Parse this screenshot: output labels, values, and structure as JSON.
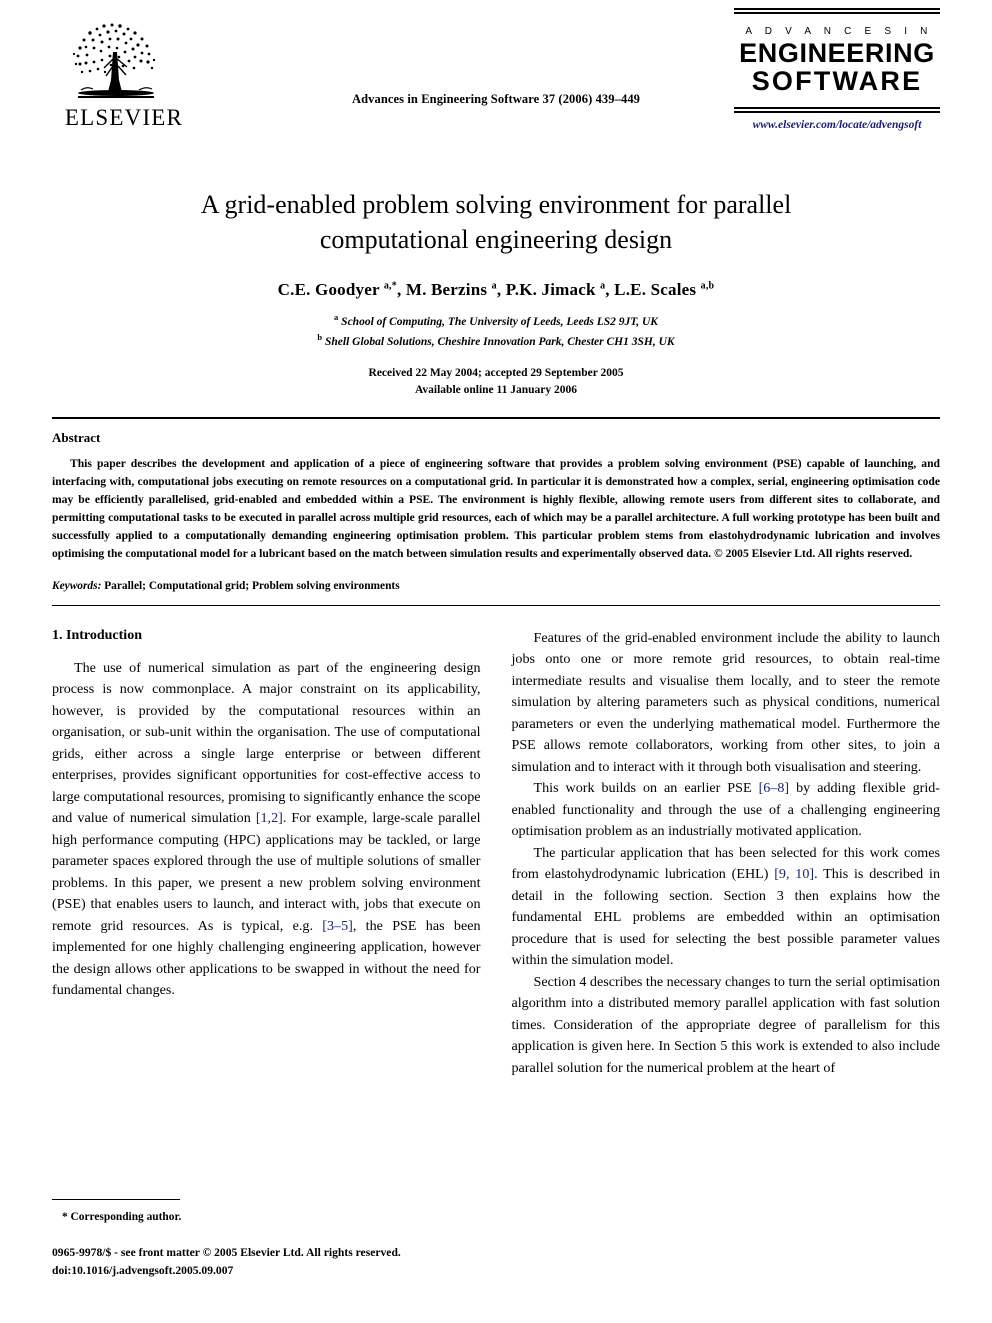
{
  "masthead": {
    "publisher_logo_word": "ELSEVIER",
    "journal_reference": "Advances in Engineering Software 37 (2006) 439–449",
    "journal_mark_line1": "A D V A N C E S   I N",
    "journal_mark_line2": "ENGINEERING",
    "journal_mark_line3": "SOFTWARE",
    "journal_url": "www.elsevier.com/locate/advengsoft",
    "url_color": "#1c1c7a"
  },
  "article": {
    "title": "A grid-enabled problem solving environment for parallel computational engineering design",
    "authors": "C.E. Goodyer <sup>a,*</sup>, M. Berzins <sup>a</sup>, P.K. Jimack <sup>a</sup>, L.E. Scales <sup>a,b</sup>",
    "affiliation_a": "<sup>a</sup> School of Computing, The University of Leeds, Leeds LS2 9JT, UK",
    "affiliation_b": "<sup>b</sup> Shell Global Solutions, Cheshire Innovation Park, Chester CH1 3SH, UK",
    "received_line": "Received 22 May 2004; accepted 29 September 2005",
    "online_line": "Available online 11 January 2006"
  },
  "abstract": {
    "heading": "Abstract",
    "body": "This paper describes the development and application of a piece of engineering software that provides a problem solving environment (PSE) capable of launching, and interfacing with, computational jobs executing on remote resources on a computational grid. In particular it is demonstrated how a complex, serial, engineering optimisation code may be efficiently parallelised, grid-enabled and embedded within a PSE. The environment is highly flexible, allowing remote users from different sites to collaborate, and permitting computational tasks to be executed in parallel across multiple grid resources, each of which may be a parallel architecture. A full working prototype has been built and successfully applied to a computationally demanding engineering optimisation problem. This particular problem stems from elastohydrodynamic lubrication and involves optimising the computational model for a lubricant based on the match between simulation results and experimentally observed data. © 2005 Elsevier Ltd. All rights reserved.",
    "keywords_label": "Keywords:",
    "keywords_value": "Parallel; Computational grid; Problem solving environments"
  },
  "body": {
    "section_heading": "1. Introduction",
    "left_paragraphs": [
      "The use of numerical simulation as part of the engineering design process is now commonplace. A major constraint on its applicability, however, is provided by the computational resources within an organisation, or sub-unit within the organisation. The use of computational grids, either across a single large enterprise or between different enterprises, provides significant opportunities for cost-effective access to large computational resources, promising to significantly enhance the scope and value of numerical simulation <span class=\"cite\">[1,2]</span>. For example, large-scale parallel high performance computing (HPC) applications may be tackled, or large parameter spaces explored through the use of multiple solutions of smaller problems. In this paper, we present a new problem solving environment (PSE) that enables users to launch, and interact with, jobs that execute on remote grid resources. As is typical, e.g. <span class=\"cite\">[3–5]</span>, the PSE has been implemented for one highly challenging engineering application, however the design allows other applications to be swapped in without the need for fundamental changes."
    ],
    "right_paragraphs": [
      "Features of the grid-enabled environment include the ability to launch jobs onto one or more remote grid resources, to obtain real-time intermediate results and visualise them locally, and to steer the remote simulation by altering parameters such as physical conditions, numerical parameters or even the underlying mathematical model. Furthermore the PSE allows remote collaborators, working from other sites, to join a simulation and to interact with it through both visualisation and steering.",
      "This work builds on an earlier PSE <span class=\"cite\">[6–8]</span> by adding flexible grid-enabled functionality and through the use of a challenging engineering optimisation problem as an industrially motivated application.",
      "The particular application that has been selected for this work comes from elastohydrodynamic lubrication (EHL) <span class=\"cite\">[9, 10]</span>. This is described in detail in the following section. Section 3 then explains how the fundamental EHL problems are embedded within an optimisation procedure that is used for selecting the best possible parameter values within the simulation model.",
      "Section 4 describes the necessary changes to turn the serial optimisation algorithm into a distributed memory parallel application with fast solution times. Consideration of the appropriate degree of parallelism for this application is given here. In Section 5 this work is extended to also include parallel solution for the numerical problem at the heart of"
    ]
  },
  "footer": {
    "corresponding_author": "* Corresponding author.",
    "front_matter": "0965-9978/$ - see front matter © 2005 Elsevier Ltd. All rights reserved.",
    "doi": "doi:10.1016/j.advengsoft.2005.09.007"
  }
}
